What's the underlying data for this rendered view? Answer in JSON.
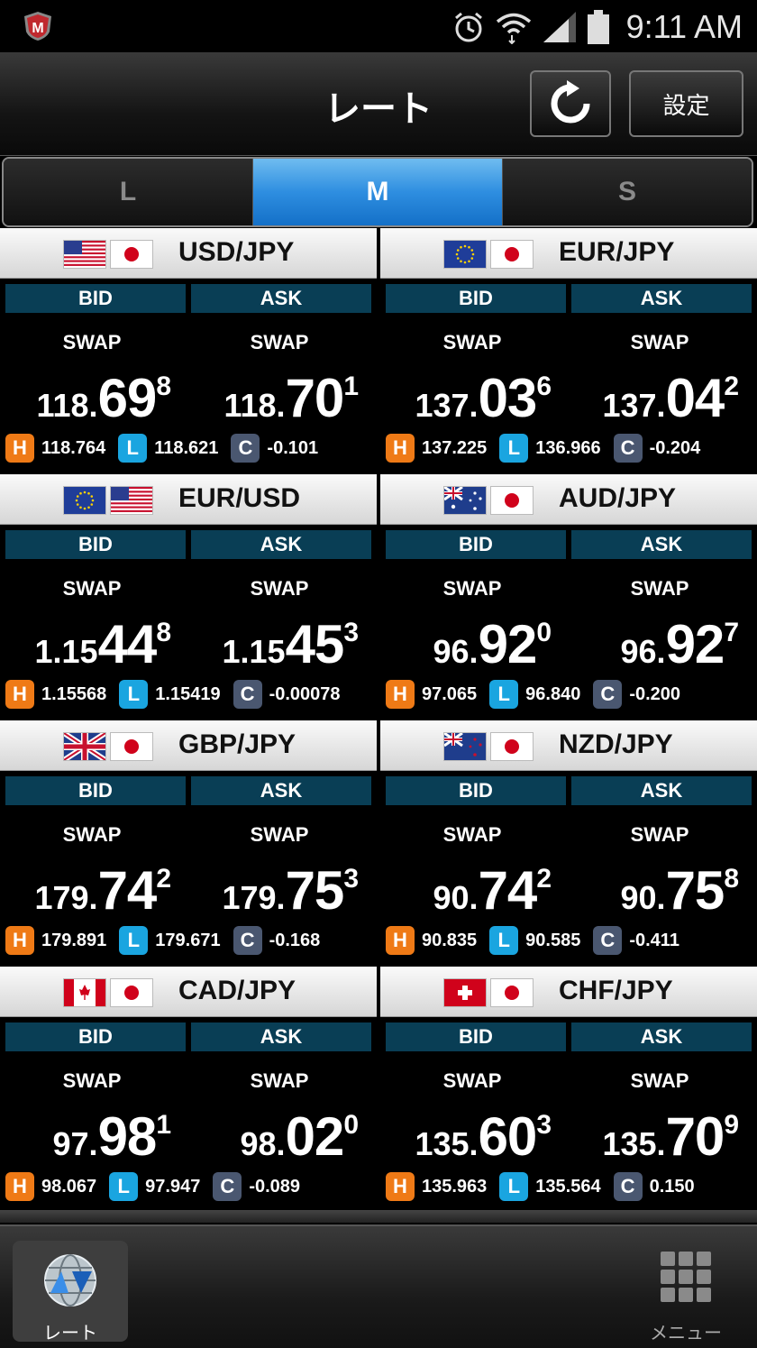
{
  "status": {
    "time": "9:11 AM"
  },
  "header": {
    "title": "レート",
    "settings_label": "設定"
  },
  "segments": [
    {
      "label": "L",
      "active": false
    },
    {
      "label": "M",
      "active": true
    },
    {
      "label": "S",
      "active": false
    }
  ],
  "labels": {
    "bid": "BID",
    "ask": "ASK",
    "swap": "SWAP",
    "high": "H",
    "low": "L",
    "change": "C"
  },
  "pairs": [
    {
      "name": "USD/JPY",
      "flags": [
        "us",
        "jp"
      ],
      "bid": {
        "pre": "118.",
        "big": "69",
        "sup": "8"
      },
      "ask": {
        "pre": "118.",
        "big": "70",
        "sup": "1"
      },
      "high": "118.764",
      "low": "118.621",
      "change": "-0.101"
    },
    {
      "name": "EUR/JPY",
      "flags": [
        "eu",
        "jp"
      ],
      "bid": {
        "pre": "137.",
        "big": "03",
        "sup": "6"
      },
      "ask": {
        "pre": "137.",
        "big": "04",
        "sup": "2"
      },
      "high": "137.225",
      "low": "136.966",
      "change": "-0.204"
    },
    {
      "name": "EUR/USD",
      "flags": [
        "eu",
        "us"
      ],
      "bid": {
        "pre": "1.15",
        "big": "44",
        "sup": "8"
      },
      "ask": {
        "pre": "1.15",
        "big": "45",
        "sup": "3"
      },
      "high": "1.15568",
      "low": "1.15419",
      "change": "-0.00078"
    },
    {
      "name": "AUD/JPY",
      "flags": [
        "au",
        "jp"
      ],
      "bid": {
        "pre": "96.",
        "big": "92",
        "sup": "0"
      },
      "ask": {
        "pre": "96.",
        "big": "92",
        "sup": "7"
      },
      "high": "97.065",
      "low": "96.840",
      "change": "-0.200"
    },
    {
      "name": "GBP/JPY",
      "flags": [
        "gb",
        "jp"
      ],
      "bid": {
        "pre": "179.",
        "big": "74",
        "sup": "2"
      },
      "ask": {
        "pre": "179.",
        "big": "75",
        "sup": "3"
      },
      "high": "179.891",
      "low": "179.671",
      "change": "-0.168"
    },
    {
      "name": "NZD/JPY",
      "flags": [
        "nz",
        "jp"
      ],
      "bid": {
        "pre": "90.",
        "big": "74",
        "sup": "2"
      },
      "ask": {
        "pre": "90.",
        "big": "75",
        "sup": "8"
      },
      "high": "90.835",
      "low": "90.585",
      "change": "-0.411"
    },
    {
      "name": "CAD/JPY",
      "flags": [
        "ca",
        "jp"
      ],
      "bid": {
        "pre": "97.",
        "big": "98",
        "sup": "1"
      },
      "ask": {
        "pre": "98.",
        "big": "02",
        "sup": "0"
      },
      "high": "98.067",
      "low": "97.947",
      "change": "-0.089"
    },
    {
      "name": "CHF/JPY",
      "flags": [
        "ch",
        "jp"
      ],
      "bid": {
        "pre": "135.",
        "big": "60",
        "sup": "3"
      },
      "ask": {
        "pre": "135.",
        "big": "70",
        "sup": "9"
      },
      "high": "135.963",
      "low": "135.564",
      "change": "0.150"
    }
  ],
  "nav": {
    "rate_label": "レート",
    "menu_label": "メニュー"
  },
  "colors": {
    "accent_blue": "#2e8ee0",
    "header_band": "#093e55",
    "high": "#ef7a16",
    "low": "#1aa5e0",
    "change": "#4a5770"
  }
}
